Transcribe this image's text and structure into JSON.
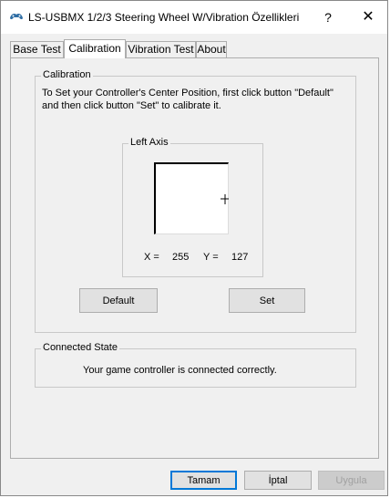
{
  "window": {
    "title": "LS-USBMX 1/2/3 Steering Wheel W/Vibration Özellikleri",
    "help": "?",
    "close": "✕"
  },
  "tabs": [
    {
      "label": "Base Test",
      "active": false
    },
    {
      "label": "Calibration",
      "active": true
    },
    {
      "label": "Vibration Test",
      "active": false
    },
    {
      "label": "About",
      "active": false
    }
  ],
  "calibration": {
    "group_title": "Calibration",
    "instructions_line1": "To Set your Controller's  Center Position, first click button \"Default\"",
    "instructions_line2": "and then click button \"Set\" to calibrate it.",
    "left_axis_title": "Left Axis",
    "x_label": "X =",
    "x_value": "255",
    "y_label": "Y =",
    "y_value": "127",
    "default_button": "Default",
    "set_button": "Set"
  },
  "connected": {
    "group_title": "Connected State",
    "status_text": "Your game controller is connected correctly."
  },
  "footer": {
    "ok": "Tamam",
    "cancel": "İptal",
    "apply": "Uygula"
  },
  "colors": {
    "focus_border": "#0078d7",
    "window_bg": "#f0f0f0"
  }
}
